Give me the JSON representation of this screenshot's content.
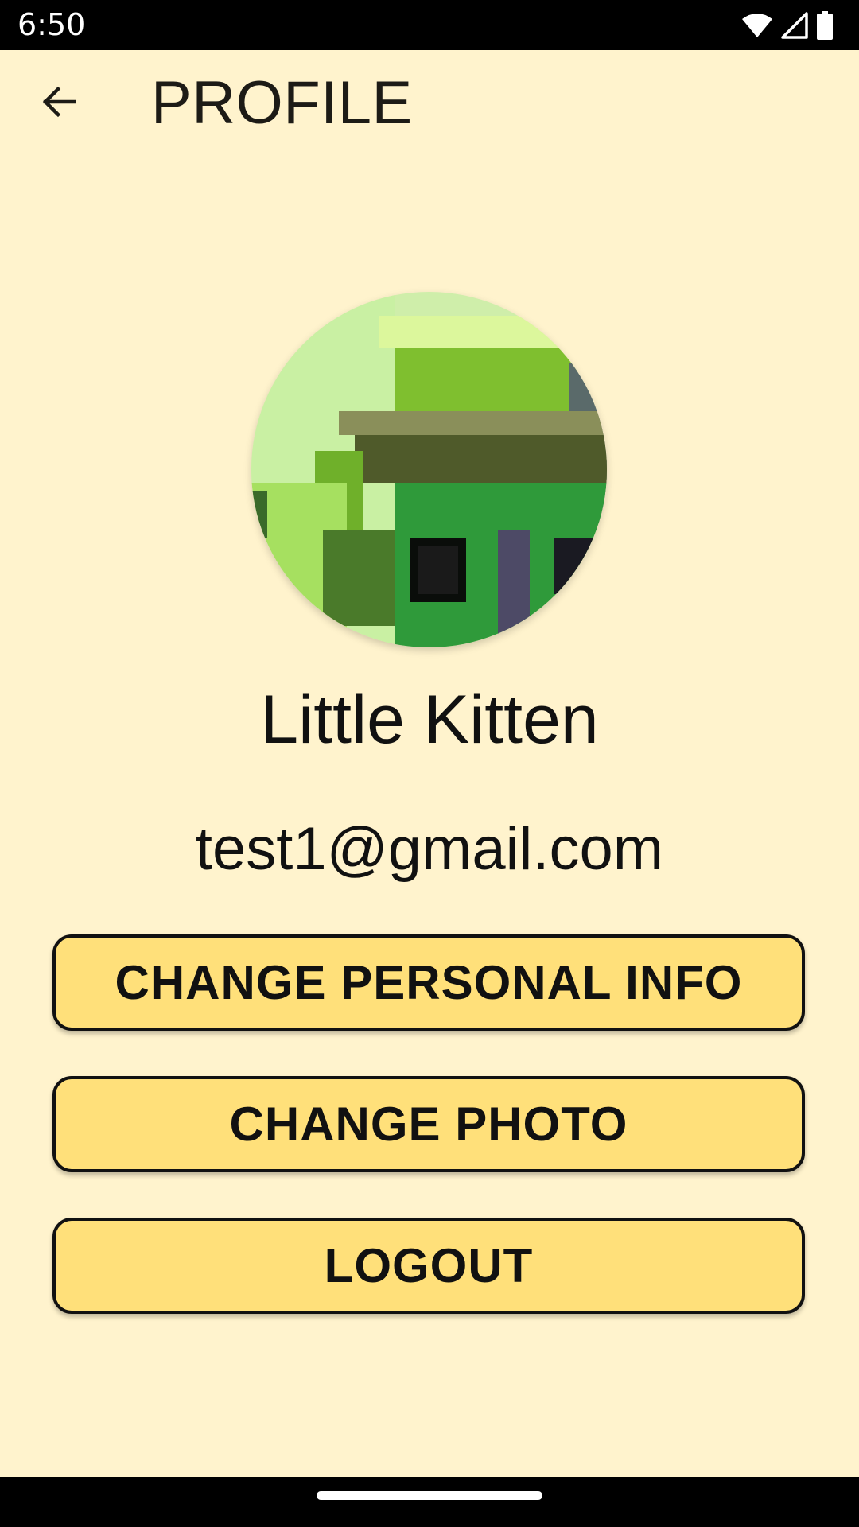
{
  "status_bar": {
    "time": "6:50",
    "icons": [
      "wifi-icon",
      "cellular-signal-icon",
      "battery-icon"
    ]
  },
  "app_bar": {
    "back_icon": "arrow-left-icon",
    "title": "PROFILE"
  },
  "profile": {
    "avatar": "profile-photo",
    "name": "Little Kitten",
    "email": "test1@gmail.com"
  },
  "actions": {
    "change_personal_info": "CHANGE PERSONAL INFO",
    "change_photo": "CHANGE PHOTO",
    "logout": "LOGOUT"
  },
  "colors": {
    "background": "#fff3cd",
    "button_fill": "#ffe07a",
    "button_border": "#111111",
    "text": "#111111"
  }
}
